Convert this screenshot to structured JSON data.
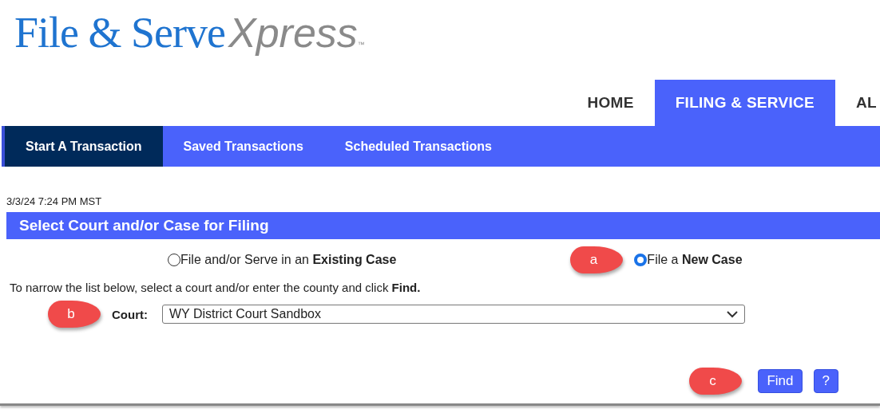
{
  "logo": {
    "brand": "File & Serve",
    "accent": "Xpress",
    "mark": "™"
  },
  "main_nav": [
    {
      "label": "HOME",
      "selected": false
    },
    {
      "label": "FILING & SERVICE",
      "selected": true
    },
    {
      "label": "AL",
      "selected": false
    }
  ],
  "sub_nav": [
    {
      "label": "Start A Transaction",
      "selected": true
    },
    {
      "label": "Saved Transactions",
      "selected": false
    },
    {
      "label": "Scheduled Transactions",
      "selected": false
    }
  ],
  "timestamp": "3/3/24 7:24 PM MST",
  "section": {
    "title": "Select Court and/or Case for Filing"
  },
  "case_options": [
    {
      "label": "File and/or Serve in an **Existing Case**",
      "selected": false
    },
    {
      "label": "File a **New Case**",
      "selected": true,
      "callout": "a"
    }
  ],
  "instructions": "To narrow the list below, select a court and/or enter the county and click **Find.**",
  "court": {
    "label": "Court:",
    "value": "WY District Court Sandbox",
    "callout": "b"
  },
  "actions": {
    "callout": "c",
    "find": "Find",
    "help": "?"
  }
}
